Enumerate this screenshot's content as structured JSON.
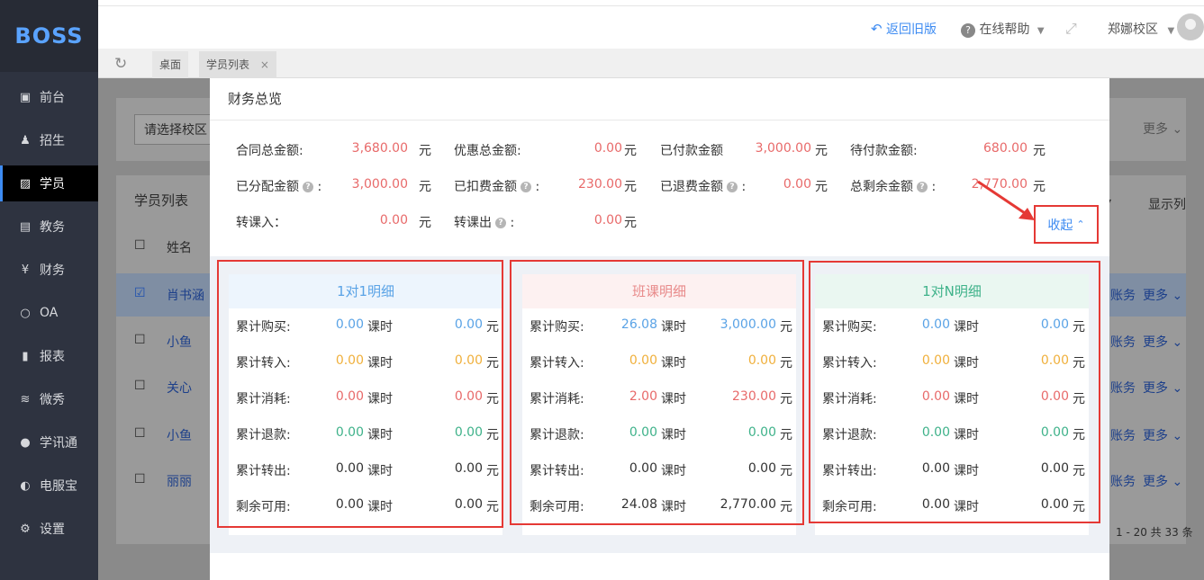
{
  "sidebar": {
    "logo": "BOSS",
    "items": [
      {
        "label": "前台",
        "icon": "monitor-icon"
      },
      {
        "label": "招生",
        "icon": "user-plus-icon"
      },
      {
        "label": "学员",
        "icon": "student-card-icon",
        "active": true
      },
      {
        "label": "教务",
        "icon": "board-icon"
      },
      {
        "label": "财务",
        "icon": "yen-icon"
      },
      {
        "label": "OA",
        "icon": "chat-icon"
      },
      {
        "label": "报表",
        "icon": "bar-chart-icon"
      },
      {
        "label": "微秀",
        "icon": "xiu-icon"
      },
      {
        "label": "学讯通",
        "icon": "location-pin-icon"
      },
      {
        "label": "电服宝",
        "icon": "phone-d-icon"
      },
      {
        "label": "设置",
        "icon": "gear-icon"
      }
    ]
  },
  "topbar": {
    "back_old": "返回旧版",
    "help": "在线帮助",
    "campus": "郑娜校区"
  },
  "tabs": {
    "desktop": "桌面",
    "students": "学员列表"
  },
  "underlay": {
    "campus_select": "请选择校区",
    "more": "更多",
    "list_title": "学员列表",
    "columns_btn": "显示列",
    "col_name": "姓名",
    "rows": [
      {
        "name": "肖书涵"
      },
      {
        "name": "小鱼"
      },
      {
        "name": "关心"
      },
      {
        "name": "小鱼"
      },
      {
        "name": "丽丽"
      }
    ],
    "row_action_account": "账务",
    "row_action_more": "更多",
    "pagination": "1 - 20  共 33 条"
  },
  "modal": {
    "title": "财务总览",
    "summary": [
      {
        "label": "合同总金额:",
        "value": "3,680.00",
        "unit": "元"
      },
      {
        "label": "优惠总金额:",
        "value": "0.00",
        "unit": "元"
      },
      {
        "label": "已付款金额",
        "value": "3,000.00",
        "unit": "元"
      },
      {
        "label": "待付款金额:",
        "value": "680.00",
        "unit": "元"
      },
      {
        "label": "已分配金额",
        "value": "3,000.00",
        "unit": "元"
      },
      {
        "label": "已扣费金额",
        "value": "230.00",
        "unit": "元"
      },
      {
        "label": "已退费金额",
        "value": "0.00",
        "unit": "元"
      },
      {
        "label": "总剩余金额",
        "value": "2,770.00",
        "unit": "元"
      },
      {
        "label": "转课入：",
        "value": "0.00",
        "unit": "元"
      },
      {
        "label": "转课出",
        "value": "0.00",
        "unit": "元"
      }
    ],
    "collapse": "收起",
    "hour_unit": "课时",
    "money_unit": "元",
    "cards": [
      {
        "title": "1对1明细",
        "title_color": "#5aa3e6",
        "head_bg": "#edf5fd",
        "rows": [
          {
            "label": "累计购买:",
            "hours": "0.00",
            "amount": "0.00",
            "color": "blue"
          },
          {
            "label": "累计转入:",
            "hours": "0.00",
            "amount": "0.00",
            "color": "orange"
          },
          {
            "label": "累计消耗:",
            "hours": "0.00",
            "amount": "0.00",
            "color": "red"
          },
          {
            "label": "累计退款:",
            "hours": "0.00",
            "amount": "0.00",
            "color": "green"
          },
          {
            "label": "累计转出:",
            "hours": "0.00",
            "amount": "0.00",
            "color": "dark"
          },
          {
            "label": "剩余可用:",
            "hours": "0.00",
            "amount": "0.00",
            "color": "dark"
          }
        ]
      },
      {
        "title": "班课明细",
        "title_color": "#e88a8a",
        "head_bg": "#fdf1f1",
        "rows": [
          {
            "label": "累计购买:",
            "hours": "26.08",
            "amount": "3,000.00",
            "color": "blue"
          },
          {
            "label": "累计转入:",
            "hours": "0.00",
            "amount": "0.00",
            "color": "orange"
          },
          {
            "label": "累计消耗:",
            "hours": "2.00",
            "amount": "230.00",
            "color": "red"
          },
          {
            "label": "累计退款:",
            "hours": "0.00",
            "amount": "0.00",
            "color": "green"
          },
          {
            "label": "累计转出:",
            "hours": "0.00",
            "amount": "0.00",
            "color": "dark"
          },
          {
            "label": "剩余可用:",
            "hours": "24.08",
            "amount": "2,770.00",
            "color": "dark"
          }
        ]
      },
      {
        "title": "1对N明细",
        "title_color": "#3fb28a",
        "head_bg": "#eaf7f1",
        "rows": [
          {
            "label": "累计购买:",
            "hours": "0.00",
            "amount": "0.00",
            "color": "blue"
          },
          {
            "label": "累计转入:",
            "hours": "0.00",
            "amount": "0.00",
            "color": "orange"
          },
          {
            "label": "累计消耗:",
            "hours": "0.00",
            "amount": "0.00",
            "color": "red"
          },
          {
            "label": "累计退款:",
            "hours": "0.00",
            "amount": "0.00",
            "color": "green"
          },
          {
            "label": "累计转出:",
            "hours": "0.00",
            "amount": "0.00",
            "color": "dark"
          },
          {
            "label": "剩余可用:",
            "hours": "0.00",
            "amount": "0.00",
            "color": "dark"
          }
        ]
      }
    ]
  },
  "colors": {
    "accent": "#3d8bf2",
    "sidebar_bg": "#2e3340",
    "annotation_red": "#e53935"
  }
}
